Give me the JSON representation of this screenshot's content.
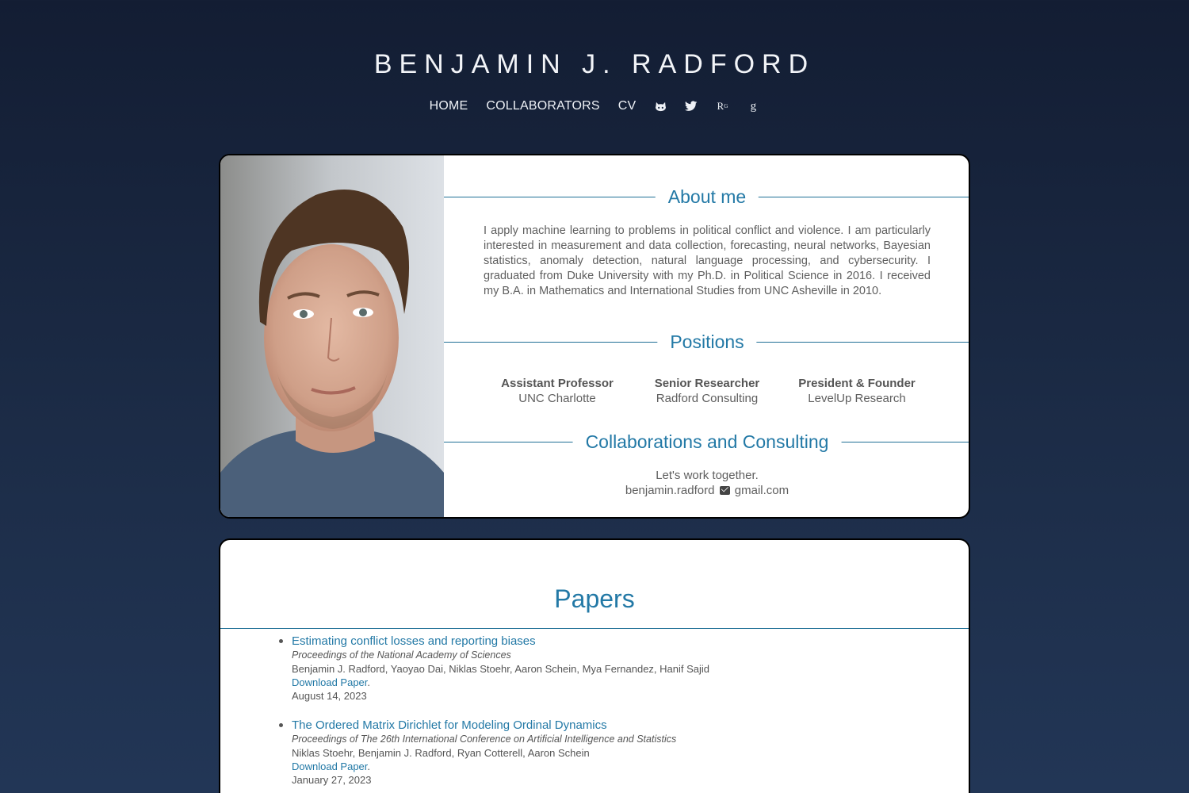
{
  "header": {
    "site_title": "BENJAMIN J. RADFORD",
    "nav": [
      {
        "label": "HOME"
      },
      {
        "label": "COLLABORATORS"
      },
      {
        "label": "CV"
      }
    ],
    "social_icons": [
      "github-icon",
      "twitter-icon",
      "researchgate-icon",
      "google-scholar-icon"
    ],
    "researchgate_glyph": "R",
    "researchgate_super": "G",
    "scholar_glyph": "g"
  },
  "about": {
    "heading": "About me",
    "text": "I apply machine learning to problems in political conflict and violence. I am particularly interested in measurement and data collection, forecasting, neural networks, Bayesian statistics, anomaly detection, natural language processing, and cybersecurity. I graduated from Duke University with my Ph.D. in Political Science in 2016. I received my B.A. in Mathematics and International Studies from UNC Asheville in 2010."
  },
  "positions": {
    "heading": "Positions",
    "items": [
      {
        "title": "Assistant Professor",
        "org": "UNC Charlotte"
      },
      {
        "title": "Senior Researcher",
        "org": "Radford Consulting"
      },
      {
        "title": "President & Founder",
        "org": "LevelUp Research"
      }
    ]
  },
  "collaborations": {
    "heading": "Collaborations and Consulting",
    "line1": "Let's work together.",
    "email_user": "benjamin.radford",
    "email_domain": "gmail.com"
  },
  "papers": {
    "heading": "Papers",
    "items": [
      {
        "title": "Estimating conflict losses and reporting biases",
        "venue": "Proceedings of the National Academy of Sciences",
        "authors": "Benjamin J. Radford, Yaoyao Dai, Niklas Stoehr, Aaron Schein, Mya Fernandez, Hanif Sajid",
        "download": "Download Paper",
        "date": "August 14, 2023"
      },
      {
        "title": "The Ordered Matrix Dirichlet for Modeling Ordinal Dynamics",
        "venue": "Proceedings of The 26th International Conference on Artificial Intelligence and Statistics",
        "authors": "Niklas Stoehr, Benjamin J. Radford, Ryan Cotterell, Aaron Schein",
        "download": "Download Paper",
        "date": "January 27, 2023"
      }
    ]
  },
  "colors": {
    "accent": "#2379a6",
    "background_top": "#131d33",
    "background_bottom": "#223656"
  }
}
